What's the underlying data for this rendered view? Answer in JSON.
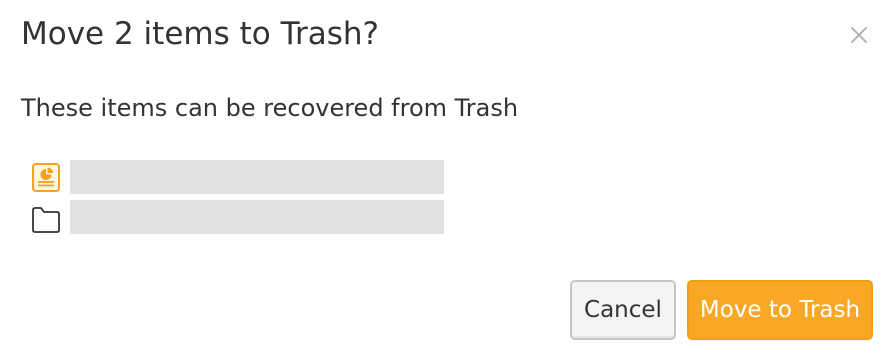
{
  "dialog": {
    "title": "Move 2 items to Trash?",
    "description": "These items can be recovered from Trash",
    "close_icon": "close-icon",
    "items": [
      {
        "icon": "presentation-chart-icon",
        "name": ""
      },
      {
        "icon": "folder-icon",
        "name": ""
      }
    ],
    "buttons": {
      "cancel_label": "Cancel",
      "confirm_label": "Move to Trash"
    }
  },
  "colors": {
    "accent": "#f9a825",
    "text": "#333333",
    "placeholder_bar": "#e2e2e2",
    "close_icon": "#b5b5b5"
  }
}
